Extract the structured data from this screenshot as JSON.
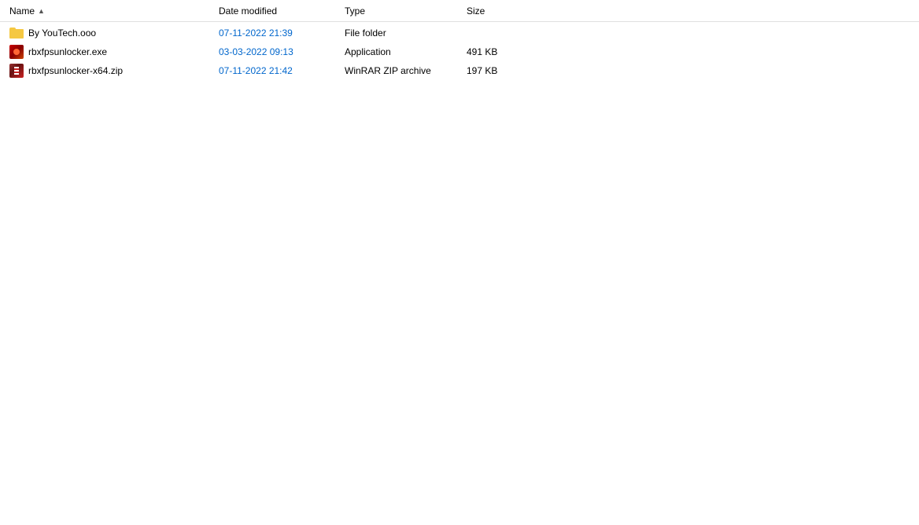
{
  "columns": {
    "name": "Name",
    "dateModified": "Date modified",
    "type": "Type",
    "size": "Size"
  },
  "files": [
    {
      "name": "By YouTech.ooo",
      "dateModified": "07-11-2022 21:39",
      "type": "File folder",
      "size": "",
      "iconType": "folder"
    },
    {
      "name": "rbxfpsunlocker.exe",
      "dateModified": "03-03-2022 09:13",
      "type": "Application",
      "size": "491 KB",
      "iconType": "exe"
    },
    {
      "name": "rbxfpsunlocker-x64.zip",
      "dateModified": "07-11-2022 21:42",
      "type": "WinRAR ZIP archive",
      "size": "197 KB",
      "iconType": "zip"
    }
  ]
}
